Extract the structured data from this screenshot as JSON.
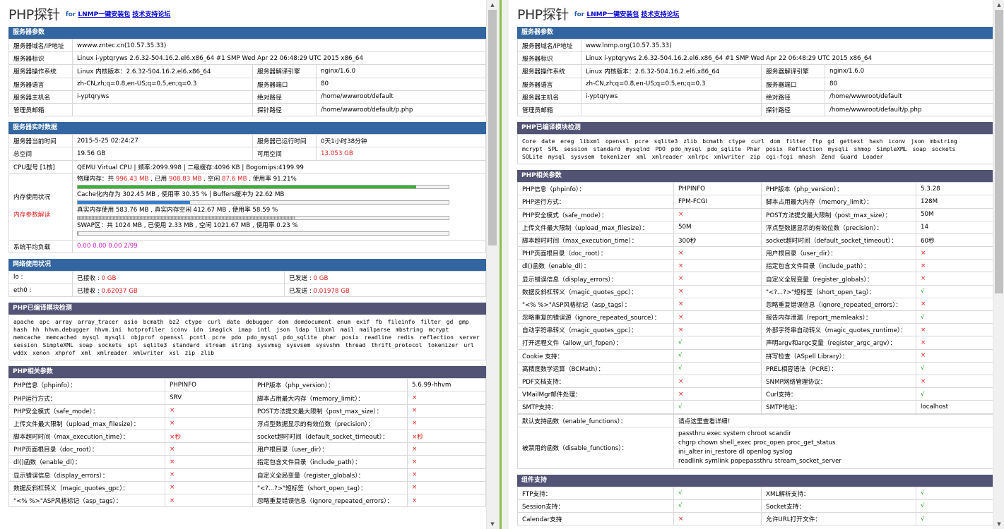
{
  "left": {
    "header": {
      "logo": "PHP探针",
      "for_text": "for",
      "link1": "LNMP一键安装包",
      "link2": "技术支持论坛"
    },
    "server_params": {
      "title": "服务器参数",
      "rows": [
        {
          "k": "服务器域名/IP地址",
          "v": "wwww.zntec.cn(10.57.35.33)"
        },
        {
          "k": "服务器标识",
          "v": "Linux i-yptqryws 2.6.32-504.16.2.el6.x86_64 #1 SMP Wed Apr 22 06:48:29 UTC 2015 x86_64"
        }
      ],
      "pairs": [
        {
          "k1": "服务器操作系统",
          "v1": "Linux  内核版本：2.6.32-504.16.2.el6.x86_64",
          "k2": "服务器解译引擎",
          "v2": "nginx/1.6.0"
        },
        {
          "k1": "服务器语言",
          "v1": "zh-CN,zh;q=0.8,en-US;q=0.5,en;q=0.3",
          "k2": "服务器端口",
          "v2": "80"
        },
        {
          "k1": "服务器主机名",
          "v1": "i-yptqryws",
          "k2": "绝对路径",
          "v2": "/home/wwwroot/default"
        },
        {
          "k1": "管理员邮箱",
          "v1": "",
          "k2": "探针路径",
          "v2": "/home/wwwroot/default/p.php"
        }
      ]
    },
    "realtime": {
      "title": "服务器实时数据",
      "pairs": [
        {
          "k1": "服务器当前时间",
          "v1": "2015-5-25 02:24:27",
          "k2": "服务器已运行时间",
          "v2": "0天1小时38分钟"
        },
        {
          "k1": "总空间",
          "v1": "19.56 GB",
          "k2": "可用空间",
          "v2": "13.053 GB"
        }
      ],
      "cpu_label": "CPU型号 [1核]",
      "cpu_value": "QEMU Virtual CPU | 频率:2099.998 | 二级缓存:4096 KB | Bogomips:4199.99",
      "mem_label": "内存使用状况",
      "mem_label2": "内存参数解读",
      "mem_phys_pre": "物理内存：共 ",
      "mem_phys_total": "996.43 MB",
      "mem_phys_mid1": " , 已用 ",
      "mem_phys_used": "908.83 MB",
      "mem_phys_mid2": " , 空闲 ",
      "mem_phys_free": "87.6 MB",
      "mem_phys_post": " , 使用率 91.21%",
      "mem_phys_ratio": 0.9121,
      "mem_cache": "Cache化内存为 302.45 MB , 使用率 30.35 % | Buffers缓冲为 22.62 MB",
      "mem_cache_ratio": 0.3035,
      "mem_real": "真实内存使用 583.76 MB , 真实内存空闲 412.67 MB , 使用率 58.59 %",
      "mem_real_ratio": 0.5859,
      "mem_swap": "SWAP区：共 1024 MB , 已使用 2.33 MB , 空闲 1021.67 MB , 使用率 0.23 %",
      "mem_swap_ratio": 0.0023,
      "load_label": "系统平均负载",
      "load_value": "0.00 0.00 0.00 2/99"
    },
    "network": {
      "title": "网络使用状况",
      "rows": [
        {
          "name": "lo :",
          "rx_label": "已接收 : ",
          "rx": "0 GB",
          "tx_label": "已发送 : ",
          "tx": "0 GB"
        },
        {
          "name": "eth0 :",
          "rx_label": "已接收 : ",
          "rx": "0.62037 GB",
          "tx_label": "已发送 : ",
          "tx": "0.01978 GB"
        }
      ]
    },
    "modules": {
      "title": "PHP已编译模块检测",
      "text": "apache  apc  array  array_tracer  asio  bcmath  bz2  ctype  curl  date  debugger  dom  domdocument  enum  exif  fb  fileinfo  filter  gd  gmp  hash  hh  hhvm.debugger  hhvm.ini  hotprofiler  iconv  idn  imagick  imap  intl  json  ldap  libxml  mail  mailparse  mbstring  mcrypt  memcache  memcached  mysql  mysqli  objprof  openssl  pcntl  pcre  pdo  pdo_mysql  pdo_sqlite  phar  posix  readline  redis  reflection  server  session  SimpleXML  soap  sockets  spl  sqlite3  standard  stream  string  sysvmsg  sysvsem  sysvshm  thread  thrift_protocol  tokenizer  url  wddx  xenon  xhprof  xml  xmlreader  xmlwriter  xsl  zip  zlib"
    },
    "php_params": {
      "title": "PHP相关参数",
      "rows": [
        {
          "k1": "PHP信息（phpinfo）：",
          "v1": "PHPINFO",
          "k2": "PHP版本（php_version）：",
          "v2": "5.6.99-hhvm"
        },
        {
          "k1": "PHP运行方式：",
          "v1": "SRV",
          "k2": "脚本占用最大内存（memory_limit）：",
          "v2": "×"
        },
        {
          "k1": "PHP安全模式（safe_mode）：",
          "v1": "×",
          "k2": "POST方法提交最大限制（post_max_size）：",
          "v2": "×"
        },
        {
          "k1": "上传文件最大限制（upload_max_filesize）：",
          "v1": "×",
          "k2": "浮点型数据显示的有效位数（precision）：",
          "v2": "×"
        },
        {
          "k1": "脚本超时时间（max_execution_time）：",
          "v1": "×秒",
          "k2": "socket超时时间（default_socket_timeout）：",
          "v2": "×秒"
        },
        {
          "k1": "PHP页面根目录（doc_root）：",
          "v1": "×",
          "k2": "用户根目录（user_dir）：",
          "v2": "×"
        },
        {
          "k1": "dl()函数（enable_dl）：",
          "v1": "×",
          "k2": "指定包含文件目录（include_path）：",
          "v2": "×"
        },
        {
          "k1": "显示错误信息（display_errors）：",
          "v1": "×",
          "k2": "自定义全局变量（register_globals）：",
          "v2": "×"
        },
        {
          "k1": "数据反斜杠转义（magic_quotes_gpc）：",
          "v1": "×",
          "k2": "\"<?...?>\"短标签（short_open_tag）：",
          "v2": "×"
        },
        {
          "k1": "\"<% %>\"ASP风格标记（asp_tags）：",
          "v1": "×",
          "k2": "忽略重复错误信息（ignore_repeated_errors）：",
          "v2": "×"
        }
      ]
    }
  },
  "right": {
    "header": {
      "logo": "PHP探针",
      "for_text": "for",
      "link1": "LNMP一键安装包",
      "link2": "技术支持论坛"
    },
    "server_params": {
      "title": "服务器参数",
      "rows": [
        {
          "k": "服务器域名/IP地址",
          "v": "www.lnmp.org(10.57.35.33)"
        },
        {
          "k": "服务器标识",
          "v": "Linux i-yptqryws 2.6.32-504.16.2.el6.x86_64 #1 SMP Wed Apr 22 06:48:29 UTC 2015 x86_64"
        }
      ],
      "pairs": [
        {
          "k1": "服务器操作系统",
          "v1": "Linux  内核版本：2.6.32-504.16.2.el6.x86_64",
          "k2": "服务器解译引擎",
          "v2": "nginx/1.6.0"
        },
        {
          "k1": "服务器语言",
          "v1": "zh-CN,zh;q=0.8,en-US;q=0.5,en;q=0.3",
          "k2": "服务器端口",
          "v2": "80"
        },
        {
          "k1": "服务器主机名",
          "v1": "i-yptqryws",
          "k2": "绝对路径",
          "v2": "/home/wwwroot/default"
        },
        {
          "k1": "管理员邮箱",
          "v1": "",
          "k2": "探针路径",
          "v2": "/home/wwwroot/default/p.php"
        }
      ]
    },
    "modules": {
      "title": "PHP已编译模块检测",
      "text": "Core  date  ereg  libxml  openssl  pcre  sqlite3  zlib  bcmath  ctype  curl  dom  filter  ftp  gd  gettext  hash  iconv  json  mbstring  mcrypt  SPL  session  standard  mysqlnd  PDO  pdo_mysql  pdo_sqlite  Phar  posix  Reflection  mysqli  shmop  SimpleXML  soap  sockets  SQLite  mysql  sysvsem  tokenizer  xml  xmlreader  xmlrpc  xmlwriter  zip  cgi-fcgi  mhash  Zend Guard Loader"
    },
    "php_params": {
      "title": "PHP相关参数",
      "rows": [
        {
          "k1": "PHP信息（phpinfo）：",
          "v1": "PHPINFO",
          "k2": "PHP版本（php_version）：",
          "v2": "5.3.28"
        },
        {
          "k1": "PHP运行方式：",
          "v1": "FPM-FCGI",
          "k2": "脚本占用最大内存（memory_limit）：",
          "v2": "128M"
        },
        {
          "k1": "PHP安全模式（safe_mode）：",
          "v1": "×",
          "k2": "POST方法提交最大限制（post_max_size）：",
          "v2": "50M"
        },
        {
          "k1": "上传文件最大限制（upload_max_filesize）：",
          "v1": "50M",
          "k2": "浮点型数据显示的有效位数（precision）：",
          "v2": "14"
        },
        {
          "k1": "脚本超时时间（max_execution_time）：",
          "v1": "300秒",
          "k2": "socket超时时间（default_socket_timeout）：",
          "v2": "60秒"
        },
        {
          "k1": "PHP页面根目录（doc_root）：",
          "v1": "×",
          "k2": "用户根目录（user_dir）：",
          "v2": "×"
        },
        {
          "k1": "dl()函数（enable_dl）：",
          "v1": "×",
          "k2": "指定包含文件目录（include_path）：",
          "v2": "×"
        },
        {
          "k1": "显示错误信息（display_errors）：",
          "v1": "×",
          "k2": "自定义全局变量（register_globals）：",
          "v2": "×"
        },
        {
          "k1": "数据反斜杠转义（magic_quotes_gpc）：",
          "v1": "×",
          "k2": "\"<?...?>\"短标签（short_open_tag）：",
          "v2": "√"
        },
        {
          "k1": "\"<% %>\"ASP风格标记（asp_tags）：",
          "v1": "×",
          "k2": "忽略重复错误信息（ignore_repeated_errors）：",
          "v2": "×"
        },
        {
          "k1": "忽略重复的错误源（ignore_repeated_source）：",
          "v1": "×",
          "k2": "报告内存泄漏（report_memleaks）：",
          "v2": "√"
        },
        {
          "k1": "自动字符串转义（magic_quotes_gpc）：",
          "v1": "×",
          "k2": "外部字符串自动转义（magic_quotes_runtime）：",
          "v2": "×"
        },
        {
          "k1": "打开远程文件（allow_url_fopen）：",
          "v1": "√",
          "k2": "声明argv和argc变量（register_argc_argv）：",
          "v2": "×"
        },
        {
          "k1": "Cookie 支持：",
          "v1": "√",
          "k2": "拼写检查（ASpell Library）：",
          "v2": "×"
        },
        {
          "k1": "高精度数学运算（BCMath）：",
          "v1": "√",
          "k2": "PREL相容语法（PCRE）：",
          "v2": "√"
        },
        {
          "k1": "PDF文档支持：",
          "v1": "×",
          "k2": "SNMP网络管理协议：",
          "v2": "×"
        },
        {
          "k1": "VMailMgr邮件处理：",
          "v1": "×",
          "k2": "Curl支持：",
          "v2": "√"
        },
        {
          "k1": "SMTP支持：",
          "v1": "√",
          "k2": "SMTP地址：",
          "v2": "localhost"
        }
      ],
      "enable_functions_label": "默认支持函数（enable_functions）：",
      "enable_functions_value": "请点这里查看详细！",
      "disable_functions_label": "被禁用的函数（disable_functions）：",
      "disable_lines": [
        "passthru  exec  system  chroot  scandir",
        "chgrp  chown  shell_exec  proc_open  proc_get_status",
        "ini_alter  ini_restore  dl  openlog  syslog",
        "readlink  symlink  popepassthru  stream_socket_server"
      ]
    },
    "components": {
      "title": "组件支持",
      "rows": [
        {
          "k1": "FTP支持：",
          "v1": "√",
          "k2": "XML解析支持：",
          "v2": "√"
        },
        {
          "k1": "Session支持：",
          "v1": "√",
          "k2": "Socket支持：",
          "v2": "√"
        },
        {
          "k1": "Calendar支持",
          "v1": "×",
          "k2": "允许URL打开文件：",
          "v2": "√"
        }
      ]
    }
  },
  "colors": {
    "section_blue": "#3366a0",
    "section_purple": "#525375",
    "error_red": "#e02020",
    "ok_green": "#22aa22",
    "load_magenta": "#d020d0"
  }
}
